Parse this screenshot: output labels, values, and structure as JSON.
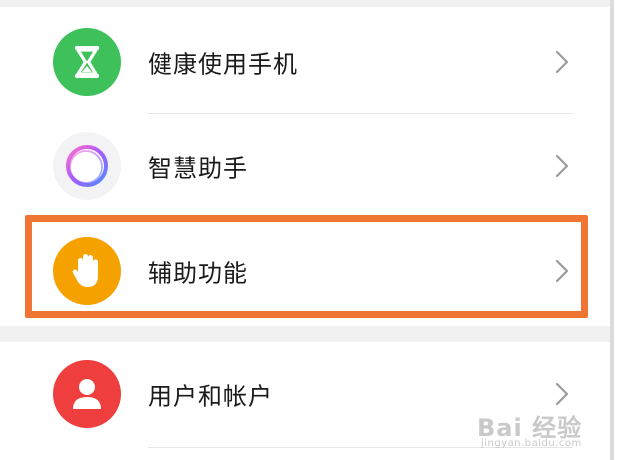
{
  "settings_list": [
    {
      "label": "健康使用手机",
      "icon": "hourglass-icon",
      "icon_color": "#3ec15a"
    },
    {
      "label": "智慧助手",
      "icon": "assistant-ring-icon",
      "icon_color": "#b25cf0"
    },
    {
      "label": "辅助功能",
      "icon": "hand-icon",
      "icon_color": "#f5a100"
    },
    {
      "label": "用户和帐户",
      "icon": "user-icon",
      "icon_color": "#ef3e3e"
    }
  ],
  "highlight_color": "#f07535",
  "watermark": {
    "main": "Bai 经验",
    "sub": "jingyan.baidu.com"
  }
}
